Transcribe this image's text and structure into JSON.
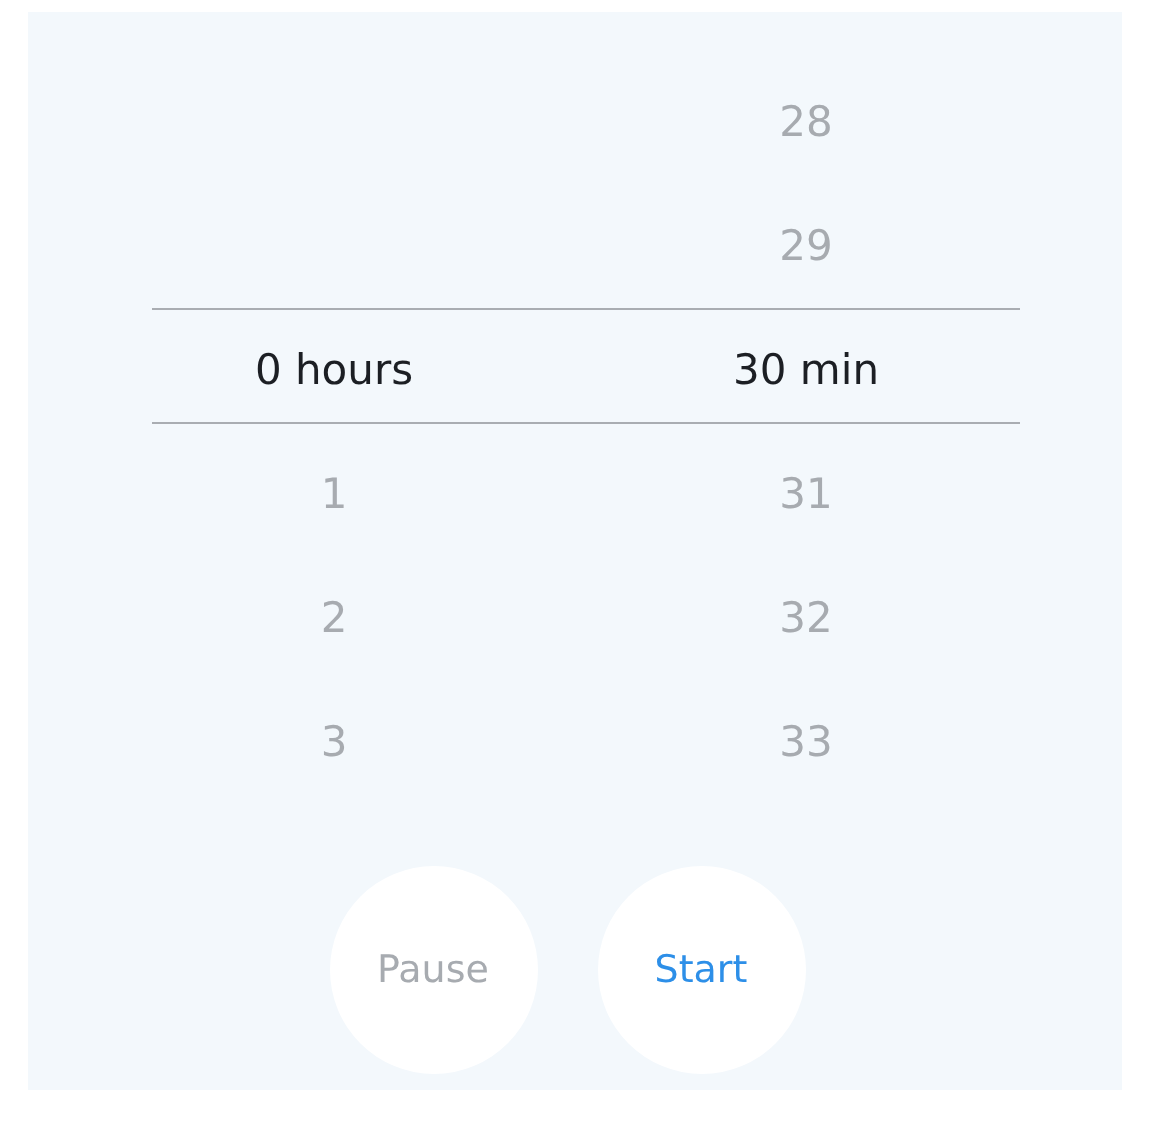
{
  "picker": {
    "columns": [
      {
        "items": [
          {
            "label": "0 hours",
            "selected": true
          },
          {
            "label": "1",
            "selected": false
          },
          {
            "label": "2",
            "selected": false
          },
          {
            "label": "3",
            "selected": false
          }
        ]
      },
      {
        "items": [
          {
            "label": "28",
            "selected": false
          },
          {
            "label": "29",
            "selected": false
          },
          {
            "label": "30 min",
            "selected": true
          },
          {
            "label": "31",
            "selected": false
          },
          {
            "label": "32",
            "selected": false
          },
          {
            "label": "33",
            "selected": false
          }
        ]
      }
    ]
  },
  "buttons": [
    {
      "label": "Pause",
      "disabled": true
    },
    {
      "label": "Start",
      "disabled": false
    }
  ]
}
